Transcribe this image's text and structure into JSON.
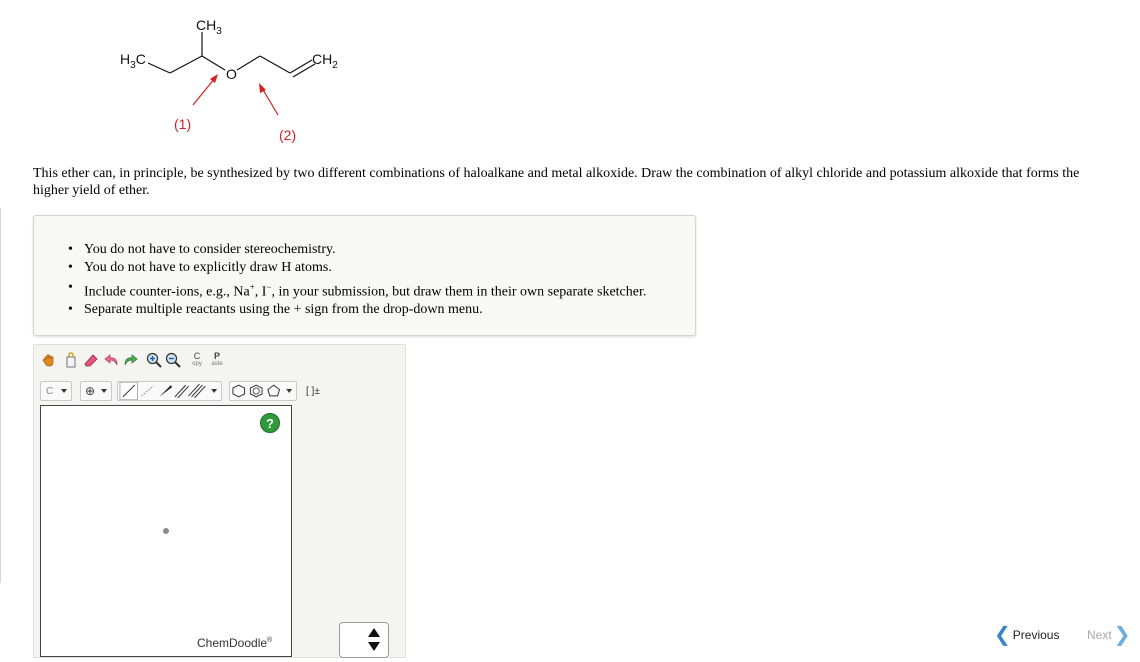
{
  "molecule": {
    "methyl_top": "CH",
    "methyl_top_sub": "3",
    "methyl_left_pre": "H",
    "methyl_left_sub": "3",
    "methyl_left_post": "C",
    "oxygen": "O",
    "methylene": "CH",
    "methylene_sub": "2",
    "bond_label_1": "(1)",
    "bond_label_2": "(2)",
    "arrow_color": "#d81e1e"
  },
  "question": {
    "text": "This ether can, in principle, be synthesized by two different combinations of haloalkane and metal alkoxide. Draw the combination of alkyl chloride and potassium alkoxide that forms the higher yield of ether."
  },
  "hints": {
    "item1": "You do not have to consider stereochemistry.",
    "item2": "You do not have to explicitly draw H atoms.",
    "item3_a": "Include counter-ions, e.g., Na",
    "item3_sup1": "+",
    "item3_b": ", I",
    "item3_sup2": "−",
    "item3_c": ", in your submission, but draw them in their own separate sketcher.",
    "item4": "Separate multiple reactants using the + sign from the drop-down menu."
  },
  "toolbar": {
    "copy_top": "C",
    "copy_bottom": "opy",
    "paste_top": "P",
    "paste_bottom": "aste",
    "element_label": "C",
    "charge_label": "⊕",
    "bracket_label": "[ ]±"
  },
  "sketcher": {
    "help_label": "?",
    "brand": "ChemDoodle",
    "brand_mark": "®"
  },
  "nav": {
    "previous": "Previous",
    "next": "Next"
  },
  "colors": {
    "accent": "#3a86c8",
    "help_green": "#2e9a3c"
  }
}
